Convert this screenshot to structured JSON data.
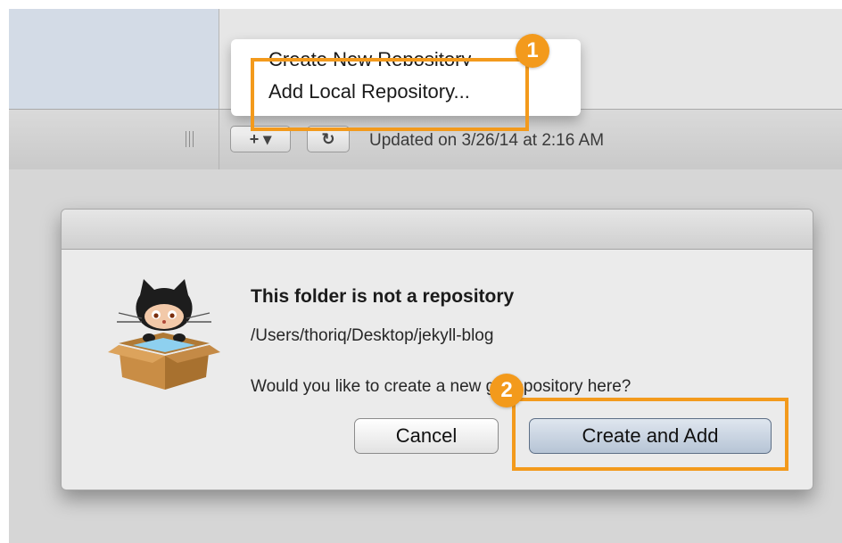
{
  "toolbar": {
    "add_label": "+ ▾",
    "refresh_label": "↻",
    "updated_text": "Updated on 3/26/14 at 2:16 AM"
  },
  "menu": {
    "items": [
      "Create New Repository",
      "Add Local Repository..."
    ]
  },
  "dialog": {
    "title": "This folder is not a repository",
    "path": "/Users/thoriq/Desktop/jekyll-blog",
    "question": "Would you like to create a new git repository here?",
    "cancel_label": "Cancel",
    "confirm_label": "Create and Add"
  },
  "annotations": {
    "step1": "1",
    "step2": "2"
  },
  "icons": {
    "dialog_icon": "octocat-in-box-icon",
    "grip": "grip-icon",
    "refresh": "refresh-icon"
  },
  "colors": {
    "annotation": "#f39a1c"
  }
}
